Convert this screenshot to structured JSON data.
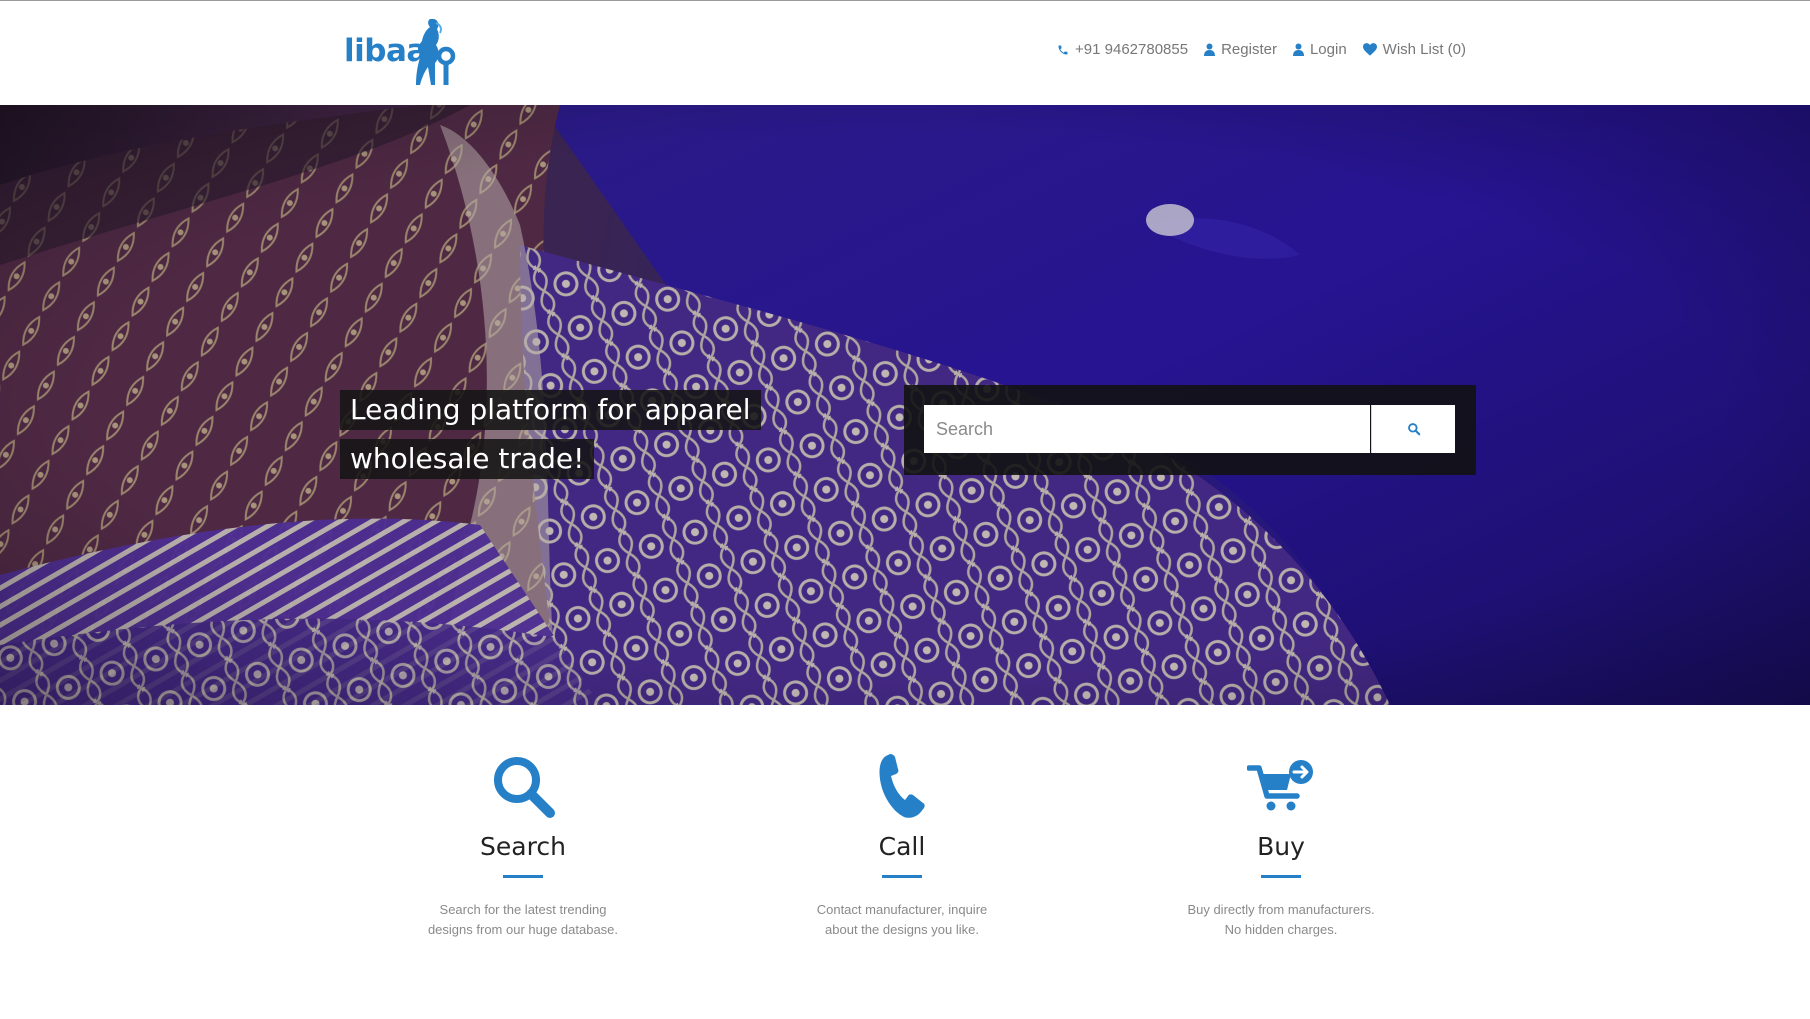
{
  "brand": {
    "logo_text": "libaas",
    "accent_color": "#2580c8"
  },
  "nav": [
    {
      "icon": "phone-icon",
      "label": "+91 9462780855"
    },
    {
      "icon": "user-icon",
      "label": "Register"
    },
    {
      "icon": "user-icon",
      "label": "Login"
    },
    {
      "icon": "heart-icon",
      "label": "Wish List (0)"
    }
  ],
  "hero": {
    "tagline_line1": "Leading platform for apparel",
    "tagline_line2": "wholesale trade!",
    "search": {
      "placeholder": "Search",
      "button_icon": "search-icon"
    }
  },
  "features": [
    {
      "icon": "search-icon",
      "title": "Search",
      "desc_line1": "Search for the latest trending",
      "desc_line2": "designs from our huge database."
    },
    {
      "icon": "phone-icon",
      "title": "Call",
      "desc_line1": "Contact manufacturer, inquire",
      "desc_line2": "about the designs you like."
    },
    {
      "icon": "cart-add-icon",
      "title": "Buy",
      "desc_line1": "Buy directly from manufacturers.",
      "desc_line2": "No hidden charges."
    }
  ]
}
